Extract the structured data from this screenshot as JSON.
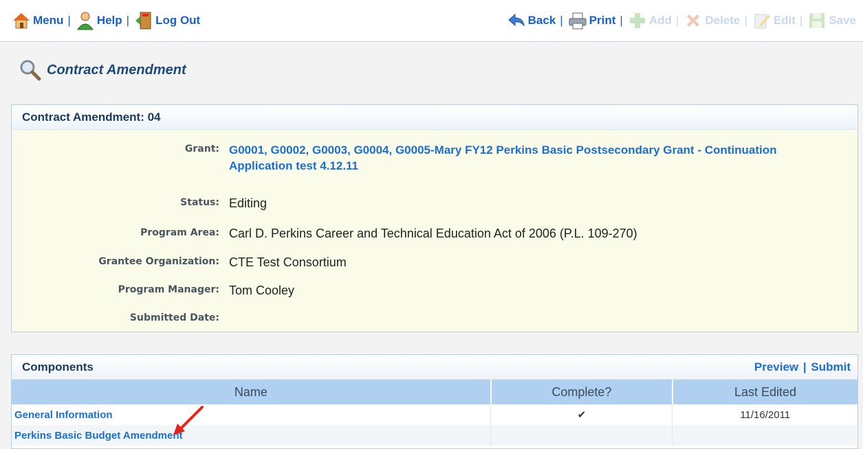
{
  "toolbar": {
    "menu": "Menu",
    "help": "Help",
    "logout": "Log Out",
    "back": "Back",
    "print": "Print",
    "add": "Add",
    "delete": "Delete",
    "edit": "Edit",
    "save": "Save",
    "sep": "|"
  },
  "page": {
    "title": "Contract Amendment"
  },
  "details": {
    "header": "Contract Amendment: 04",
    "grant_label": "Grant:",
    "grant_value": "G0001, G0002, G0003, G0004, G0005-Mary FY12 Perkins Basic Postsecondary Grant - Continuation Application test 4.12.11",
    "status_label": "Status:",
    "status_value": "Editing",
    "program_area_label": "Program Area:",
    "program_area_value": "Carl D. Perkins Career and Technical Education Act of 2006 (P.L. 109-270)",
    "grantee_label": "Grantee Organization:",
    "grantee_value": "CTE Test Consortium",
    "manager_label": "Program Manager:",
    "manager_value": "Tom Cooley",
    "submitted_label": "Submitted Date:",
    "submitted_value": ""
  },
  "components": {
    "header": "Components",
    "preview": "Preview",
    "submit": "Submit",
    "sep": "|",
    "columns": [
      "Name",
      "Complete?",
      "Last Edited"
    ],
    "rows": [
      {
        "name": "General Information",
        "complete": "✔",
        "last_edited": "11/16/2011"
      },
      {
        "name": "Perkins Basic Budget Amendment",
        "complete": "",
        "last_edited": ""
      }
    ]
  },
  "icons": {
    "menu": "house-icon",
    "help": "person-help-icon",
    "logout": "exit-door-icon",
    "back": "back-arrow-icon",
    "print": "printer-icon",
    "add": "plus-icon",
    "delete": "x-icon",
    "edit": "edit-icon",
    "save": "floppy-disk-icon",
    "title": "magnifier-icon",
    "annotation": "red-arrow-annotation"
  },
  "colors": {
    "link": "#1a6fd1",
    "disabled": "#c8d8ea",
    "accent_arrow": "#e8231b"
  }
}
